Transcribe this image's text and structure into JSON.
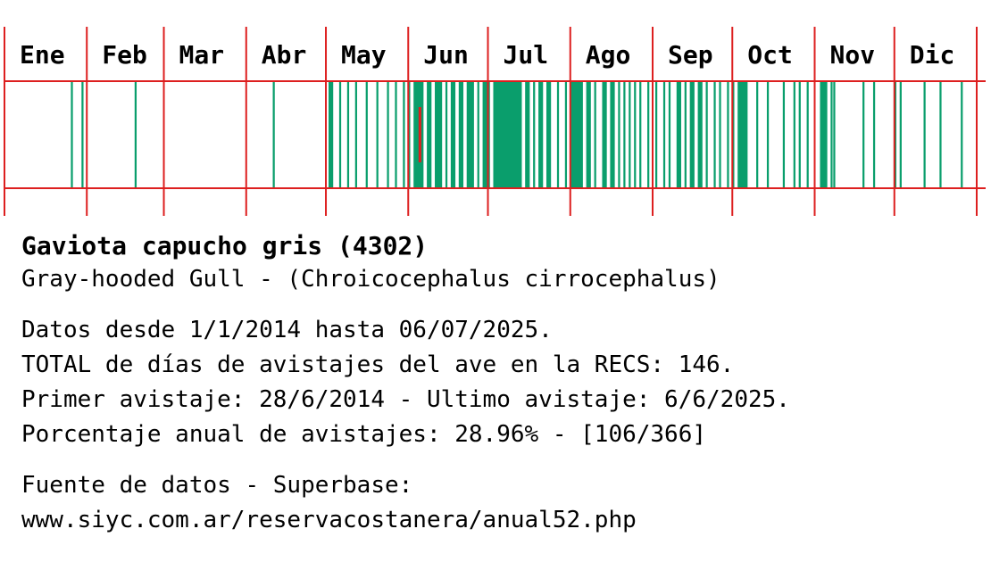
{
  "chart_data": {
    "type": "timeline",
    "months": [
      "Ene",
      "Feb",
      "Mar",
      "Abr",
      "May",
      "Jun",
      "Jul",
      "Ago",
      "Sep",
      "Oct",
      "Nov",
      "Dic"
    ],
    "days_in_year": 366,
    "year_type": "leap",
    "sighting_day_ranges": [
      [
        26,
        26
      ],
      [
        30,
        30
      ],
      [
        50,
        50
      ],
      [
        102,
        102
      ],
      [
        123,
        124
      ],
      [
        127,
        127
      ],
      [
        130,
        130
      ],
      [
        133,
        133
      ],
      [
        137,
        137
      ],
      [
        141,
        141
      ],
      [
        145,
        145
      ],
      [
        148,
        148
      ],
      [
        151,
        151
      ],
      [
        153,
        153
      ],
      [
        155,
        158
      ],
      [
        160,
        161
      ],
      [
        163,
        165
      ],
      [
        167,
        167
      ],
      [
        169,
        170
      ],
      [
        172,
        173
      ],
      [
        175,
        177
      ],
      [
        179,
        179
      ],
      [
        181,
        183
      ],
      [
        185,
        195
      ],
      [
        197,
        198
      ],
      [
        200,
        200
      ],
      [
        202,
        203
      ],
      [
        205,
        206
      ],
      [
        209,
        209
      ],
      [
        212,
        212
      ],
      [
        214,
        218
      ],
      [
        220,
        221
      ],
      [
        223,
        223
      ],
      [
        226,
        227
      ],
      [
        229,
        230
      ],
      [
        232,
        232
      ],
      [
        234,
        234
      ],
      [
        236,
        236
      ],
      [
        238,
        238
      ],
      [
        240,
        240
      ],
      [
        243,
        243
      ],
      [
        246,
        246
      ],
      [
        249,
        249
      ],
      [
        251,
        251
      ],
      [
        254,
        255
      ],
      [
        257,
        257
      ],
      [
        259,
        260
      ],
      [
        262,
        263
      ],
      [
        265,
        265
      ],
      [
        268,
        268
      ],
      [
        270,
        270
      ],
      [
        273,
        273
      ],
      [
        275,
        275
      ],
      [
        277,
        280
      ],
      [
        284,
        284
      ],
      [
        288,
        288
      ],
      [
        294,
        294
      ],
      [
        298,
        298
      ],
      [
        300,
        300
      ],
      [
        303,
        303
      ],
      [
        308,
        310
      ],
      [
        312,
        312
      ],
      [
        313,
        313
      ],
      [
        324,
        324
      ],
      [
        328,
        328
      ],
      [
        336,
        336
      ],
      [
        338,
        338
      ],
      [
        347,
        347
      ],
      [
        353,
        353
      ],
      [
        361,
        361
      ]
    ],
    "last_sighting_day": 157
  },
  "bird": {
    "title": "Gaviota capucho gris (4302)",
    "subtitle": "Gray-hooded Gull - (Chroicocephalus cirrocephalus)"
  },
  "stats": {
    "line1": "Datos desde 1/1/2014 hasta 06/07/2025.",
    "line2": "TOTAL de días de avistajes del ave en la RECS: 146.",
    "line3": "Primer avistaje: 28/6/2014 - Ultimo avistaje: 6/6/2025.",
    "line4": "Porcentaje anual de avistajes: 28.96% - [106/366]"
  },
  "source": {
    "line1": "Fuente de datos - Superbase:",
    "line2": "www.siyc.com.ar/reservacostanera/anual52.php"
  },
  "colors": {
    "grid": "#dd1f1f",
    "bar": "#0a9e6c",
    "last_marker": "#dd1f1f",
    "background": "#ffffff"
  }
}
